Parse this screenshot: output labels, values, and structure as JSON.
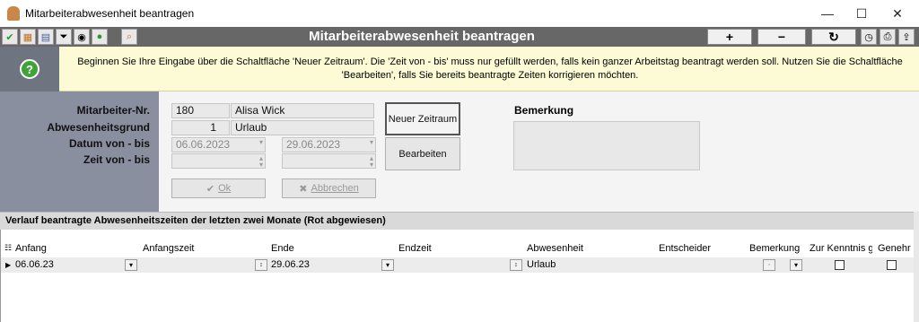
{
  "window": {
    "title": "Mitarbeiterabwesenheit beantragen"
  },
  "toolbar": {
    "title": "Mitarbeiterabwesenheit beantragen",
    "add_label": "+",
    "remove_label": "−",
    "refresh_label": "↻"
  },
  "info": {
    "text": "Beginnen Sie Ihre Eingabe über die Schaltfläche 'Neuer Zeitraum'. Die 'Zeit von - bis' muss nur gefüllt werden, falls kein ganzer Arbeitstag beantragt werden soll. Nutzen Sie die Schaltfläche 'Bearbeiten', falls Sie bereits beantragte Zeiten korrigieren möchten."
  },
  "form": {
    "labels": {
      "mitarbeiter": "Mitarbeiter-Nr.",
      "grund": "Abwesenheitsgrund",
      "datum": "Datum von - bis",
      "zeit": "Zeit von - bis"
    },
    "mitarbeiter_nr": "180",
    "mitarbeiter_name": "Alisa Wick",
    "grund_nr": "1",
    "grund_name": "Urlaub",
    "datum_von": "06.06.2023",
    "datum_bis": "29.06.2023",
    "zeit_von": "",
    "zeit_bis": "",
    "ok_label": "Ok",
    "abbrechen_label": "Abbrechen",
    "neuer_zeitraum_label": "Neuer Zeitraum",
    "bearbeiten_label": "Bearbeiten",
    "bemerkung_label": "Bemerkung"
  },
  "history": {
    "heading": "Verlauf beantragte Abwesenheitszeiten der letzten zwei Monate (Rot abgewiesen)",
    "columns": [
      "Anfang",
      "Anfangszeit",
      "Ende",
      "Endzeit",
      "Abwesenheit",
      "Entscheider",
      "Bemerkung",
      "Zur Kenntnis g",
      "Genehr"
    ],
    "rows": [
      {
        "anfang": "06.06.23",
        "anfangszeit": "",
        "ende": "29.06.23",
        "endzeit": "",
        "abwesenheit": "Urlaub",
        "entscheider": "",
        "bemerkung": "",
        "zur_kenntnis": false,
        "genehmigt": false
      }
    ]
  }
}
